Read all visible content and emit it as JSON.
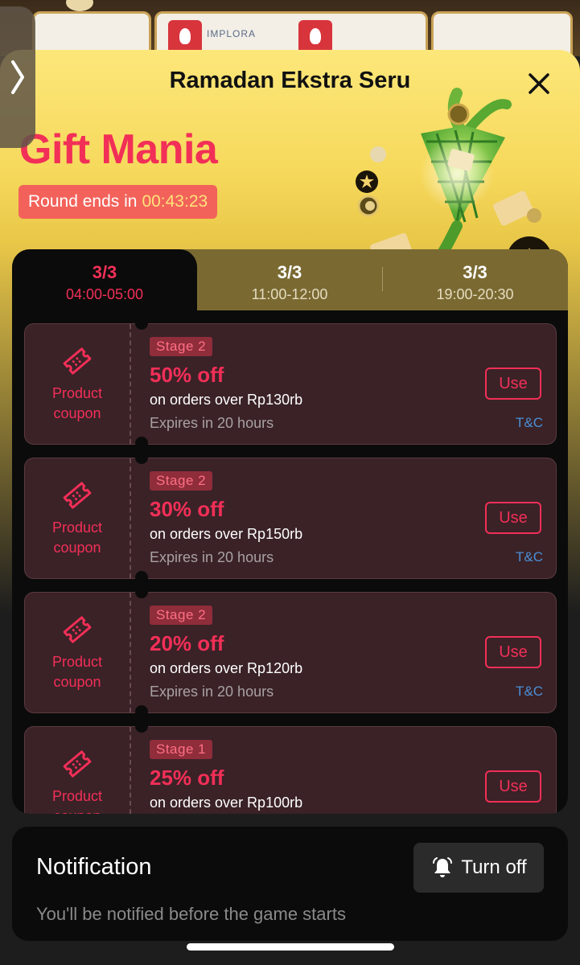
{
  "sheet": {
    "title": "Ramadan Ekstra Seru",
    "hero_title": "Gift Mania",
    "round_label": "Round ends in",
    "round_time": "00:43:23"
  },
  "background": {
    "brand_text": "IMPLORA"
  },
  "tabs": [
    {
      "date": "3/3",
      "range": "04:00-05:00",
      "active": true
    },
    {
      "date": "3/3",
      "range": "11:00-12:00",
      "active": false
    },
    {
      "date": "3/3",
      "range": "19:00-20:30",
      "active": false
    }
  ],
  "coupons": [
    {
      "type": "Product coupon",
      "stage": "Stage 2",
      "discount": "50% off",
      "condition": "on orders over Rp130rb",
      "expiry": "Expires in 20 hours",
      "button": "Use",
      "tc": "T&C"
    },
    {
      "type": "Product coupon",
      "stage": "Stage 2",
      "discount": "30% off",
      "condition": "on orders over Rp150rb",
      "expiry": "Expires in 20 hours",
      "button": "Use",
      "tc": "T&C"
    },
    {
      "type": "Product coupon",
      "stage": "Stage 2",
      "discount": "20% off",
      "condition": "on orders over Rp120rb",
      "expiry": "Expires in 20 hours",
      "button": "Use",
      "tc": "T&C"
    },
    {
      "type": "Product coupon",
      "stage": "Stage 1",
      "discount": "25% off",
      "condition": "on orders over Rp100rb",
      "expiry": "",
      "button": "Use",
      "tc": ""
    }
  ],
  "notification": {
    "title": "Notification",
    "description": "You'll be notified before the game starts",
    "button": "Turn off",
    "icon": "bell-icon"
  },
  "colors": {
    "accent": "#f22f57",
    "coupon_bg": "#3a2227",
    "link": "#4b8fd6",
    "tab_strip": "#7a6a32"
  },
  "icons": {
    "close": "close-icon",
    "coupon": "ticket-icon",
    "side": "chevron-right-icon"
  }
}
